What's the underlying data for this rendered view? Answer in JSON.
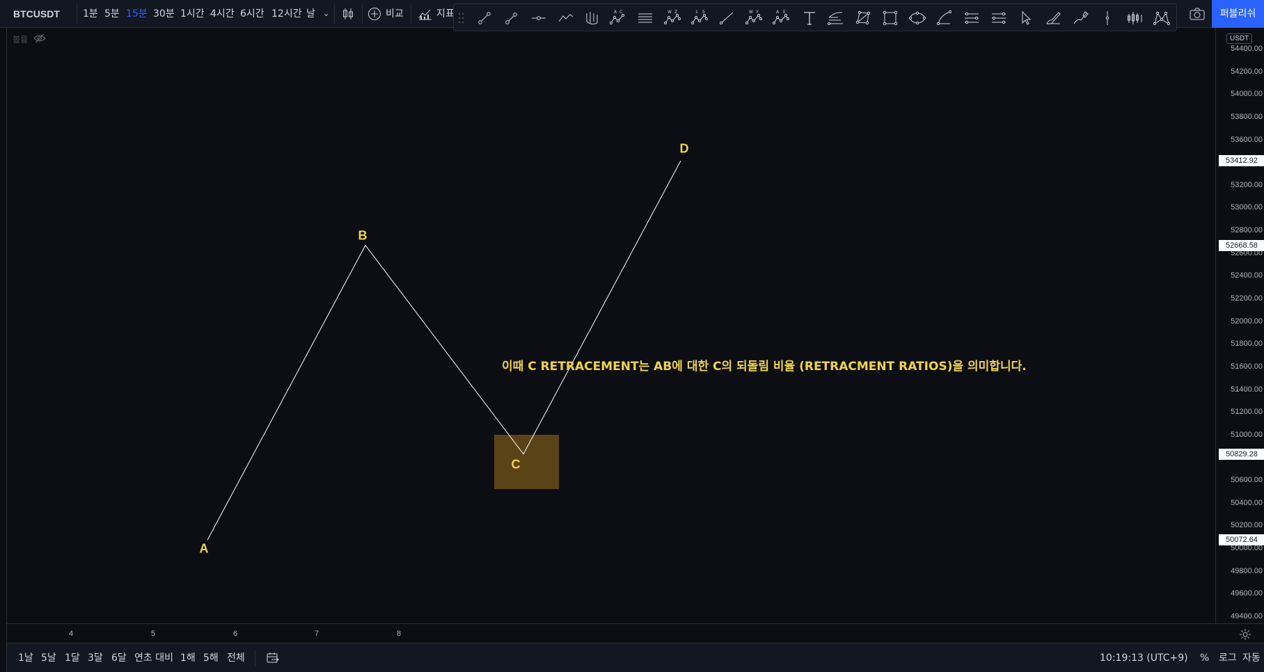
{
  "toolbar": {
    "symbol": "BTCUSDT",
    "timeframes": [
      "1분",
      "5분",
      "15분",
      "30분",
      "1시간",
      "4시간",
      "6시간",
      "12시간",
      "날"
    ],
    "active_timeframe": "15분",
    "compare_label": "비교",
    "indicators_label": "지표",
    "publish_label": "퍼블리쉬"
  },
  "legend": {
    "volume_label": "볼륨"
  },
  "drawing_tools": [
    "trend-line-icon",
    "ray-icon",
    "horizontal-segment-icon",
    "path-icon",
    "pitchfork-icon",
    "abcd-pattern-icon",
    "parallel-channel-icon",
    "wz-wave-icon",
    "15-wave-icon",
    "line-icon",
    "wy-wave-icon",
    "ae-wave-icon",
    "text-icon",
    "fib-icon",
    "polygon-icon",
    "rectangle-icon",
    "ellipse-icon",
    "arc-icon",
    "price-range-icon",
    "date-range-icon",
    "cursor-icon",
    "brush-icon",
    "highlighter-icon",
    "vertical-line-icon",
    "bars-pattern-icon",
    "xabcd-pattern-icon"
  ],
  "drawing_tool_labels": {
    "abcd": [
      "A",
      "C"
    ],
    "wz": [
      "W",
      "Z"
    ],
    "wave15": [
      "1",
      "5"
    ],
    "wy": [
      "W",
      "Y"
    ],
    "ae": [
      "A",
      "E"
    ]
  },
  "price_axis": {
    "currency": "USDT",
    "ticks": [
      "54400.00",
      "54200.00",
      "54000.00",
      "53800.00",
      "53600.00",
      "53200.00",
      "53000.00",
      "52800.00",
      "52600.00",
      "52400.00",
      "52200.00",
      "52000.00",
      "51800.00",
      "51600.00",
      "51400.00",
      "51200.00",
      "51000.00",
      "50600.00",
      "50400.00",
      "50200.00",
      "50000.00",
      "49800.00",
      "49600.00",
      "49400.00"
    ],
    "highlighted": [
      "53412.92",
      "52668.58",
      "50829.28",
      "50072.64"
    ]
  },
  "time_axis": {
    "ticks": [
      "4",
      "5",
      "6",
      "7",
      "8"
    ]
  },
  "pattern": {
    "points": [
      {
        "label": "A",
        "price": 50072.64
      },
      {
        "label": "B",
        "price": 52668.58
      },
      {
        "label": "C",
        "price": 50829.28
      },
      {
        "label": "D",
        "price": 53412.92
      }
    ],
    "line_color": "#ffffff",
    "label_color": "#f0d44a",
    "note": "이때 C RETRACEMENT는 AB에 대한 C의 되돌림 비율 (RETRACMENT RATIOS)을 의미합니다.",
    "highlight_color": "#5b4318"
  },
  "bottombar": {
    "ranges": [
      "1날",
      "5날",
      "1달",
      "3달",
      "6달",
      "연초 대비",
      "1해",
      "5해",
      "전체"
    ],
    "time": "10:19:13 (UTC+9)",
    "percent_label": "%",
    "log_label": "로그",
    "auto_label": "자동"
  },
  "colors": {
    "accent": "#2962ff",
    "background": "#0c0e13",
    "panel": "#131722"
  }
}
